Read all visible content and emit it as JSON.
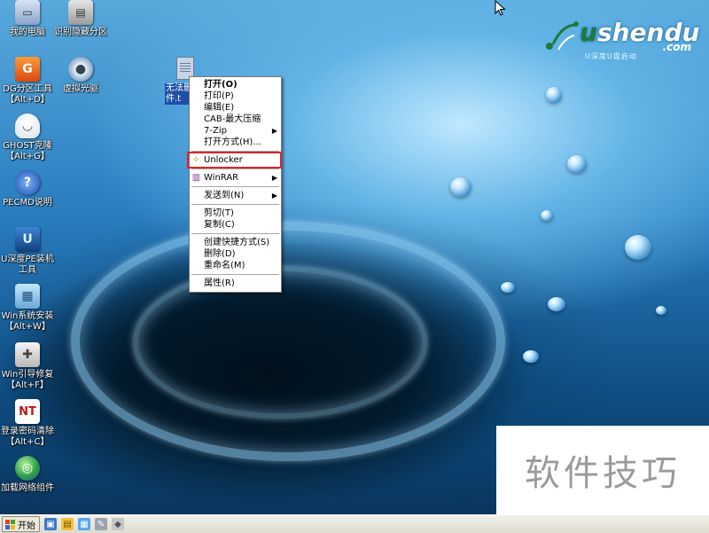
{
  "desktop": {
    "icons": [
      {
        "name": "my-computer",
        "label": "我的电脑"
      },
      {
        "name": "recognize-partition",
        "label": "识别隐藏分区"
      },
      {
        "name": "dg-partition-tool",
        "label": "DG分区工具\n【Alt+D】"
      },
      {
        "name": "virtual-cdrom",
        "label": "虚拟光驱"
      },
      {
        "name": "ghost",
        "label": "GHOST克隆\n【Alt+G】"
      },
      {
        "name": "pecmd-help",
        "label": "PECMD说明"
      },
      {
        "name": "udeep-pe-tool",
        "label": "U深度PE装机\n工具"
      },
      {
        "name": "win-installer",
        "label": "Win系统安装\n【Alt+W】"
      },
      {
        "name": "win-boot-repair",
        "label": "Win引导修复\n【Alt+F】"
      },
      {
        "name": "password-clear",
        "label": "登录密码清除\n【Alt+C】"
      },
      {
        "name": "load-network",
        "label": "加载网络组件"
      }
    ],
    "file": {
      "label": "无法删\n件.t"
    }
  },
  "logo": {
    "brand_u": "u",
    "brand_rest": "shendu",
    "dotcom": ".com",
    "tagline": "U深度U盘启动"
  },
  "context_menu": {
    "items": [
      {
        "label": "打开(O)",
        "bold": true
      },
      {
        "label": "打印(P)"
      },
      {
        "label": "编辑(E)"
      },
      {
        "label": "CAB-最大压缩"
      },
      {
        "label": "7-Zip",
        "submenu": true
      },
      {
        "label": "打开方式(H)..."
      },
      {
        "label": "Unlocker",
        "highlighted": true
      },
      {
        "label": "WinRAR",
        "submenu": true
      },
      {
        "label": "发送到(N)",
        "submenu": true
      },
      {
        "label": "剪切(T)"
      },
      {
        "label": "复制(C)"
      },
      {
        "label": "创建快捷方式(S)"
      },
      {
        "label": "删除(D)"
      },
      {
        "label": "重命名(M)"
      },
      {
        "label": "属性(R)"
      }
    ]
  },
  "taskbar": {
    "start_label": "开始"
  },
  "watermark": {
    "text": "软件技巧"
  },
  "colors": {
    "highlight_border": "#d9272e",
    "selection": "#1f4fa8",
    "taskbar": "#e4e1d6"
  }
}
